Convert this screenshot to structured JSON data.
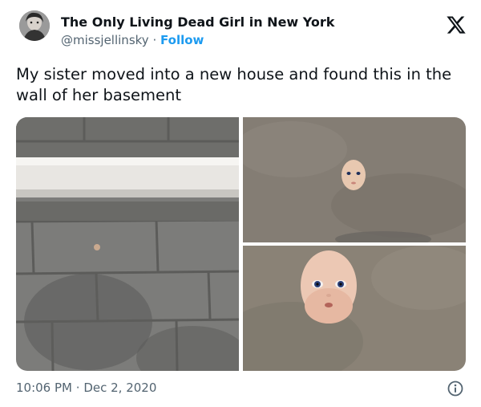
{
  "author": {
    "display_name": "The Only Living Dead Girl in New York",
    "handle": "@missjellinsky",
    "separator": "·",
    "follow_label": "Follow"
  },
  "tweet": {
    "text": "My sister moved into a new house and found this in the wall of her basement"
  },
  "meta": {
    "time": "10:06 PM",
    "separator": "·",
    "date": "Dec 2, 2020"
  },
  "colors": {
    "accent": "#1d9bf0",
    "text": "#0f1419",
    "muted": "#536471"
  },
  "icons": {
    "logo": "x-logo-icon",
    "info": "info-icon"
  }
}
